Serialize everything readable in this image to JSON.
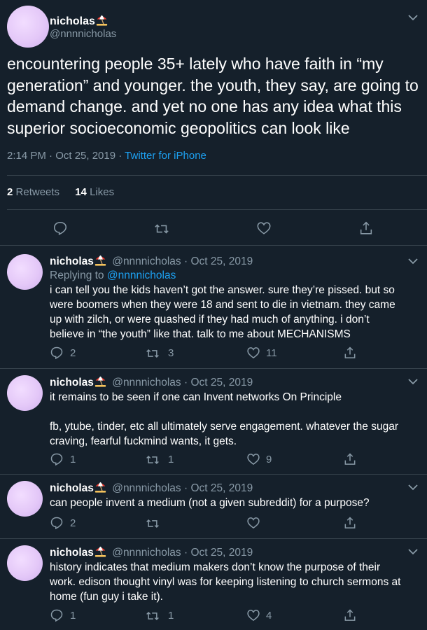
{
  "colors": {
    "background": "#15202b",
    "muted": "#8899a6",
    "link": "#1da1f2",
    "divider": "#38444d"
  },
  "icons": [
    "umbrella-on-beach-emoji",
    "chevron-down-icon",
    "reply-icon",
    "retweet-icon",
    "like-icon",
    "share-icon"
  ],
  "main_tweet": {
    "display_name": "nicholas",
    "handle": "@nnnnicholas",
    "text_lines": [
      "encountering people 35+ lately who have faith in “my",
      "generation” and younger. the youth, they say, are going to",
      "demand change. and yet no one has any idea what this",
      "superior socioeconomic geopolitics can look like"
    ],
    "timestamp": "2:14 PM · Oct 25, 2019 ·",
    "source": "Twitter for iPhone",
    "retweet_count": "2",
    "retweets_label": "Retweets",
    "like_count": "14",
    "likes_label": "Likes"
  },
  "replies": [
    {
      "display_name": "nicholas",
      "meta": "@nnnnicholas · Oct 25, 2019",
      "replying_prefix": "Replying to",
      "replying_handle": "@nnnnicholas",
      "lines": [
        "i can tell you the kids haven’t got the answer. sure they’re pissed. but so",
        "were boomers when they were 18 and sent to die in vietnam. they came",
        "up with zilch, or were quashed if they had much of anything. i don’t",
        "believe in “the youth” like that. talk to me about MECHANISMS"
      ],
      "reply_count": "2",
      "retweet_count": "3",
      "like_count": "11"
    },
    {
      "display_name": "nicholas",
      "meta": "@nnnnicholas · Oct 25, 2019",
      "lines": [
        "it remains to be seen if one can Invent networks On Principle",
        "",
        "fb, ytube, tinder, etc all ultimately serve engagement. whatever the sugar",
        "craving, fearful fuckmind wants, it gets."
      ],
      "reply_count": "1",
      "retweet_count": "1",
      "like_count": "9"
    },
    {
      "display_name": "nicholas",
      "meta": "@nnnnicholas · Oct 25, 2019",
      "lines": [
        "can people invent a medium (not a given subreddit) for a purpose?"
      ],
      "reply_count": "2",
      "retweet_count": "",
      "like_count": ""
    },
    {
      "display_name": "nicholas",
      "meta": "@nnnnicholas · Oct 25, 2019",
      "lines": [
        "history indicates that medium makers don’t know the purpose of their",
        "work. edison thought vinyl was for keeping listening to church sermons at",
        "home (fun guy i take it)."
      ],
      "reply_count": "1",
      "retweet_count": "1",
      "like_count": "4"
    }
  ]
}
